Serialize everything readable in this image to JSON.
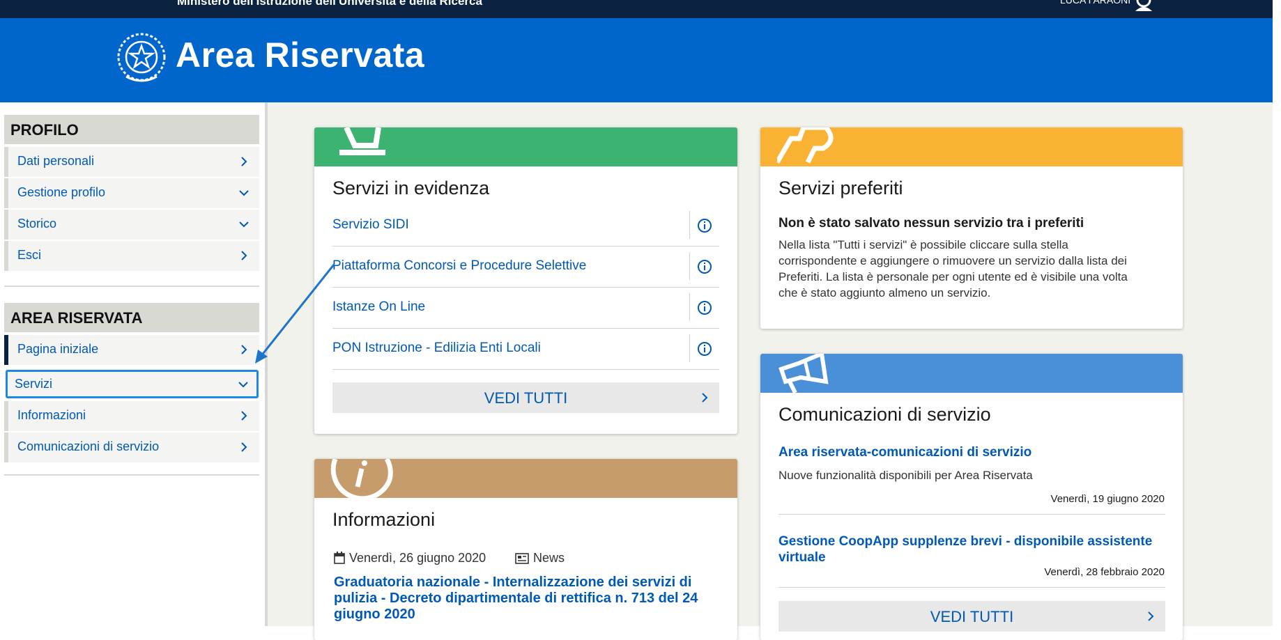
{
  "topbar": {
    "ministry": "Ministero dell'Istruzione dell'Università e della Ricerca",
    "user": "LUCA I ARAONI",
    "user_icon": "user-icon"
  },
  "header": {
    "title": "Area Riservata",
    "emblem_icon": "italian-republic-emblem"
  },
  "sidebar": {
    "profilo": {
      "heading": "PROFILO",
      "items": [
        {
          "label": "Dati personali",
          "icon": "chevron-right-icon"
        },
        {
          "label": "Gestione profilo",
          "icon": "chevron-down-icon"
        },
        {
          "label": "Storico",
          "icon": "chevron-down-icon"
        },
        {
          "label": "Esci",
          "icon": "chevron-right-icon"
        }
      ]
    },
    "area": {
      "heading": "AREA RISERVATA",
      "items": [
        {
          "label": "Pagina iniziale",
          "icon": "chevron-right-icon"
        },
        {
          "label": "Servizi",
          "icon": "chevron-down-icon"
        },
        {
          "label": "Informazioni",
          "icon": "chevron-right-icon"
        },
        {
          "label": "Comunicazioni di servizio",
          "icon": "chevron-right-icon"
        }
      ]
    }
  },
  "cards": {
    "evidenza": {
      "title": "Servizi in evidenza",
      "color": "#3cb371",
      "icon": "bell-icon",
      "items": [
        {
          "label": "Servizio SIDI",
          "icon": "info-icon"
        },
        {
          "label": "Piattaforma Concorsi e Procedure Selettive",
          "icon": "info-icon"
        },
        {
          "label": "Istanze On Line",
          "icon": "info-icon"
        },
        {
          "label": "PON Istruzione - Edilizia Enti Locali",
          "icon": "info-icon"
        }
      ],
      "button": "VEDI TUTTI"
    },
    "preferiti": {
      "title": "Servizi preferiti",
      "color": "#f9b233",
      "icon": "thumbs-up-icon",
      "subtitle": "Non è stato salvato nessun servizio tra i preferiti",
      "text": "Nella lista \"Tutti i servizi\" è possibile cliccare sulla stella corrispondente e aggiungere o rimuovere un servizio dalla lista dei Preferiti. La lista è personale per ogni utente ed è visibile una volta che è stato aggiunto almeno un servizio."
    },
    "informazioni": {
      "title": "Informazioni",
      "color": "#c69c6d",
      "icon": "info-circle-icon",
      "date": "Venerdì, 26 giugno 2020",
      "category": "News",
      "link": "Graduatoria nazionale - Internalizzazione dei servizi di pulizia - Decreto dipartimentale di rettifica n. 713 del 24 giugno 2020"
    },
    "comunicazioni": {
      "title": "Comunicazioni di servizio",
      "color": "#4a90d9",
      "icon": "megaphone-icon",
      "items": [
        {
          "link": "Area riservata-comunicazioni di servizio",
          "desc": "Nuove funzionalità disponibili per Area Riservata",
          "date": "Venerdì, 19 giugno 2020"
        },
        {
          "link": "Gestione CoopApp supplenze brevi - disponibile assistente virtuale",
          "desc": "",
          "date": "Venerdì, 28 febbraio 2020"
        }
      ],
      "button": "VEDI TUTTI"
    }
  }
}
